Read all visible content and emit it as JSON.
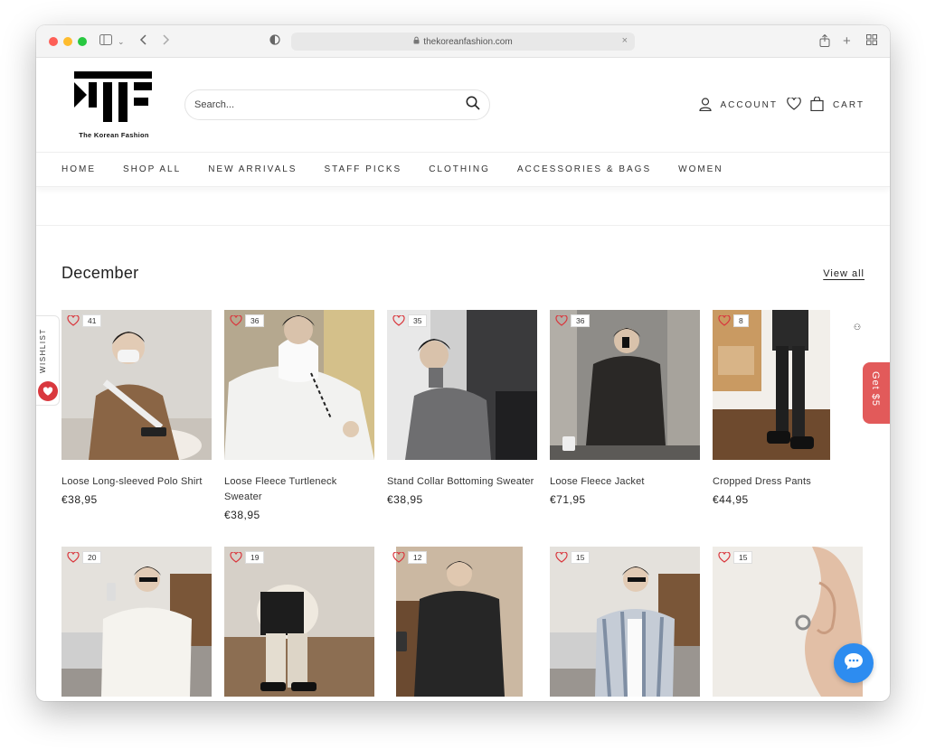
{
  "browser": {
    "url": "thekoreanfashion.com"
  },
  "header": {
    "logo_text": "The Korean Fashion",
    "search_placeholder": "Search...",
    "account_label": "ACCOUNT",
    "cart_label": "CART"
  },
  "nav": {
    "items": [
      {
        "label": "HOME"
      },
      {
        "label": "SHOP ALL"
      },
      {
        "label": "NEW ARRIVALS"
      },
      {
        "label": "STAFF PICKS"
      },
      {
        "label": "CLOTHING"
      },
      {
        "label": "ACCESSORIES & BAGS"
      },
      {
        "label": "WOMEN"
      }
    ]
  },
  "section": {
    "title": "December",
    "view_all": "View all"
  },
  "products": [
    {
      "name": "Loose Long-sleeved Polo Shirt",
      "price": "€38,95",
      "wish_count": "41"
    },
    {
      "name": "Loose Fleece Turtleneck Sweater",
      "price": "€38,95",
      "wish_count": "36"
    },
    {
      "name": "Stand Collar Bottoming Sweater",
      "price": "€38,95",
      "wish_count": "35"
    },
    {
      "name": "Loose Fleece Jacket",
      "price": "€71,95",
      "wish_count": "36"
    },
    {
      "name": "Cropped Dress Pants",
      "price": "€44,95",
      "wish_count": "8"
    },
    {
      "name": "",
      "price": "",
      "wish_count": "20"
    },
    {
      "name": "",
      "price": "",
      "wish_count": "19"
    },
    {
      "name": "",
      "price": "",
      "wish_count": "12"
    },
    {
      "name": "",
      "price": "",
      "wish_count": "15"
    },
    {
      "name": "",
      "price": "",
      "wish_count": "15"
    }
  ],
  "floating": {
    "wishlist_label": "WISHLIST",
    "promo_label": "Get $5"
  },
  "colors": {
    "accent_red": "#d9383e",
    "promo_red": "#e25a5a",
    "chat_blue": "#2d8cf0"
  }
}
